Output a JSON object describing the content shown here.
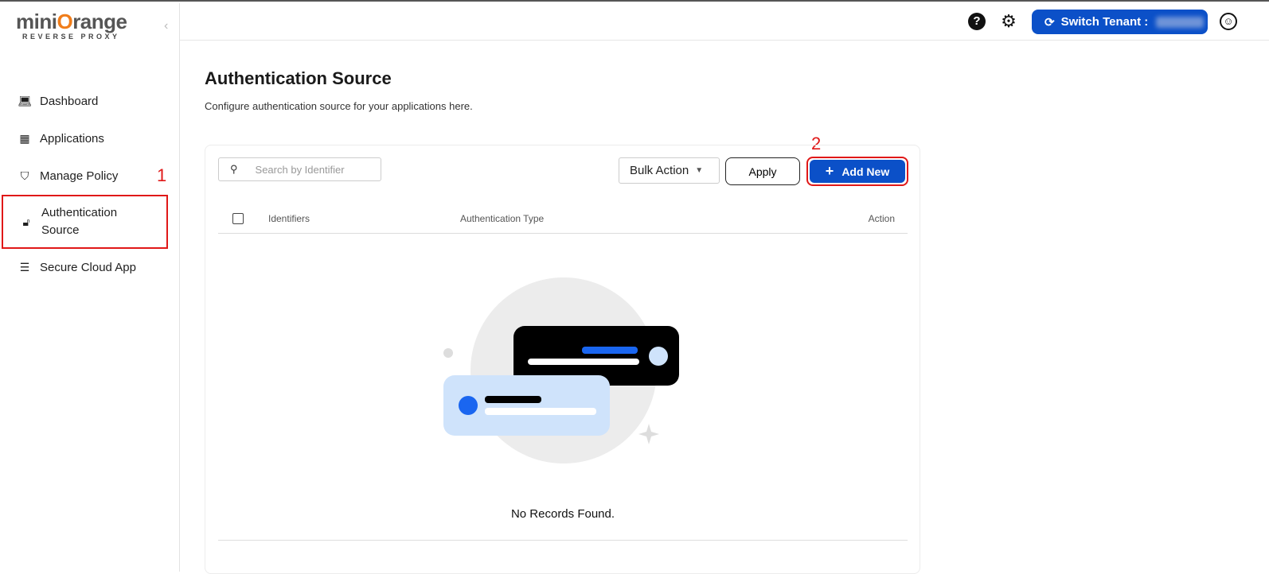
{
  "brand": {
    "name_part1": "mini",
    "name_o": "O",
    "name_part2": "range",
    "subtitle": "REVERSE PROXY"
  },
  "sidebar": {
    "items": [
      {
        "label": "Dashboard",
        "icon": "laptop-icon"
      },
      {
        "label": "Applications",
        "icon": "grid-icon"
      },
      {
        "label": "Manage Policy",
        "icon": "shield-icon"
      },
      {
        "label": "Authentication Source",
        "icon": "lock-icon",
        "active": true
      },
      {
        "label": "Secure Cloud App",
        "icon": "list-icon"
      }
    ]
  },
  "annotations": {
    "step1": "1",
    "step2": "2"
  },
  "topbar": {
    "switch_tenant_label": "Switch Tenant :"
  },
  "page": {
    "title": "Authentication Source",
    "subtitle": "Configure authentication source for your applications here."
  },
  "toolbar": {
    "search_placeholder": "Search by Identifier",
    "bulk_action": "Bulk Action",
    "apply": "Apply",
    "add_new": "Add New"
  },
  "table": {
    "columns": [
      "Identifiers",
      "Authentication Type",
      "Action"
    ],
    "empty_text": "No Records Found."
  },
  "colors": {
    "primary": "#0b50c8",
    "annotation": "#e01818",
    "accent_orange": "#f07d1a"
  }
}
